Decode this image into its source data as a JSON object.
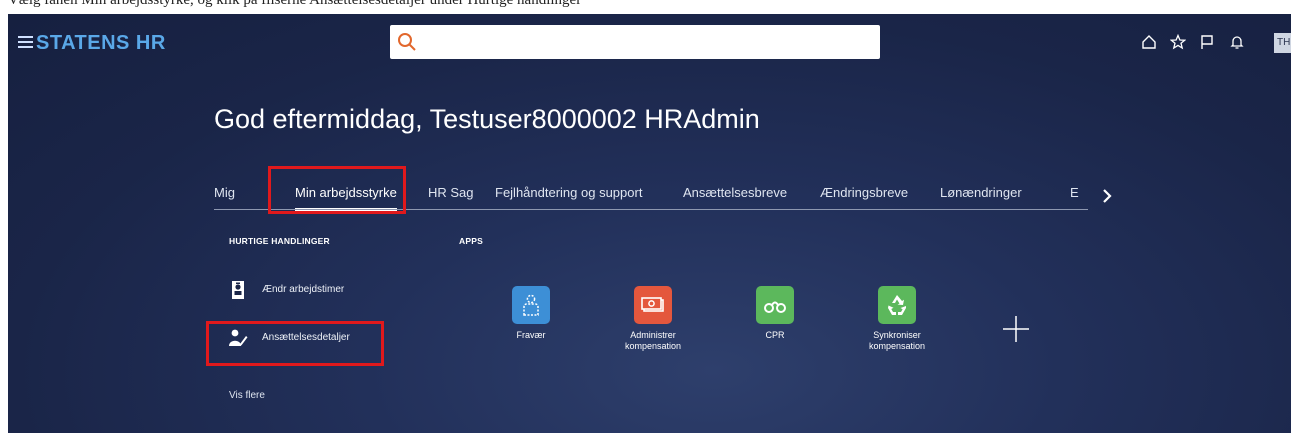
{
  "caption": "Vælg fanen Min arbejdsstyrke, og klik på fliserne Ansættelsesdetaljer under Hurtige handlinger",
  "header": {
    "brand": "STATENS HR",
    "search_value": "",
    "avatar_initials": "TH"
  },
  "greeting": "God eftermiddag, Testuser8000002 HRAdmin",
  "tabs": [
    {
      "label": "Mig",
      "active": false
    },
    {
      "label": "Min arbejdsstyrke",
      "active": true
    },
    {
      "label": "HR Sag",
      "active": false
    },
    {
      "label": "Fejlhåndtering og support",
      "active": false
    },
    {
      "label": "Ansættelsesbreve",
      "active": false
    },
    {
      "label": "Ændringsbreve",
      "active": false
    },
    {
      "label": "Lønændringer",
      "active": false
    },
    {
      "label": "E",
      "active": false
    }
  ],
  "quick_actions": {
    "heading": "HURTIGE HANDLINGER",
    "items": [
      {
        "label": "Ændr arbejdstimer",
        "icon": "id-badge-icon"
      },
      {
        "label": "Ansættelsesdetaljer",
        "icon": "person-edit-icon"
      }
    ],
    "more_label": "Vis flere"
  },
  "apps": {
    "heading": "APPS",
    "items": [
      {
        "label": "Fravær",
        "color": "#3d8fd6",
        "icon": "person-dashed-icon"
      },
      {
        "label": "Administrer kompensation",
        "color": "#e4573d",
        "icon": "money-icon"
      },
      {
        "label": "CPR",
        "color": "#5cb85c",
        "icon": "cpr-icon"
      },
      {
        "label": "Synkroniser kompensation",
        "color": "#5cb85c",
        "icon": "recycle-icon"
      }
    ]
  },
  "colors": {
    "brand": "#5aa8e8",
    "highlight": "#e0191c",
    "background": "#1a2548"
  }
}
